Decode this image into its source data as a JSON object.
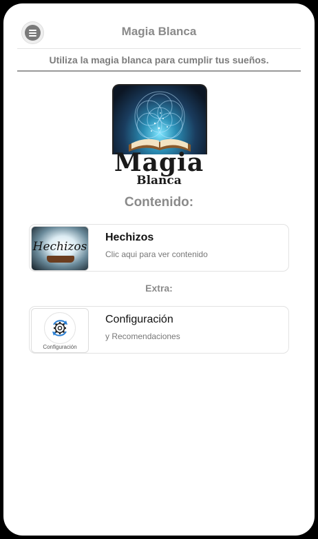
{
  "header": {
    "title": "Magia Blanca",
    "menu_icon": "hamburger-menu-icon"
  },
  "subtitle": "Utiliza la magia blanca para cumplir tus sueños.",
  "logo": {
    "word1": "Magia",
    "word2": "Blanca"
  },
  "content_heading": "Contenido:",
  "cards": [
    {
      "title": "Hechizos",
      "description": "Clic aqui para ver contenido",
      "thumb_text": "Hechizos"
    }
  ],
  "extra_heading": "Extra:",
  "extra_cards": [
    {
      "title": "Configuración",
      "description": "y Recomendaciones",
      "thumb_label": "Configuración",
      "icon": "settings-gear-icon"
    }
  ]
}
